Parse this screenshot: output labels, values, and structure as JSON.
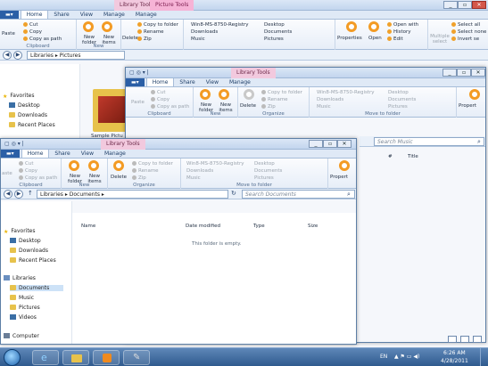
{
  "back": {
    "title_lib": "Library Tools",
    "title_pic": "Picture Tools",
    "tabs": [
      "Home",
      "Share",
      "View",
      "Manage",
      "Manage"
    ],
    "clipboard": {
      "cut": "Cut",
      "copy": "Copy",
      "copy_path": "Copy as path",
      "paste": "Paste",
      "label": "Clipboard"
    },
    "new": {
      "new_folder": "New folder",
      "new_items": "New items",
      "label": "New"
    },
    "organize": {
      "delete": "Delete",
      "copy_to": "Copy to folder",
      "rename": "Rename",
      "zip": "Zip"
    },
    "places": [
      "Win8-MS-8750-Registry",
      "Downloads",
      "Music",
      "Desktop",
      "Documents",
      "Pictures"
    ],
    "open": {
      "properties": "Properties",
      "open": "Open",
      "open_with": "Open with",
      "history": "History",
      "edit": "Edit"
    },
    "select": {
      "multiple": "Multiple select",
      "all": "Select all",
      "none": "Select none",
      "invert": "Invert se"
    },
    "address": "Libraries ▸ Pictures",
    "favorites": "Favorites",
    "fav_items": [
      "Desktop",
      "Downloads",
      "Recent Places"
    ],
    "thumb_label": "Sample Pictu"
  },
  "mid": {
    "title_lib": "Library Tools",
    "tabs": [
      "Home",
      "Share",
      "View",
      "Manage"
    ],
    "clipboard": {
      "cut": "Cut",
      "copy": "Copy",
      "copy_path": "Copy as path",
      "paste": "Paste",
      "label": "Clipboard"
    },
    "new": {
      "new_folder": "New folder",
      "new_items": "New items",
      "label": "New"
    },
    "organize": {
      "delete": "Delete",
      "copy_to": "Copy to folder",
      "rename": "Rename",
      "zip": "Zip",
      "label": "Organize"
    },
    "places": [
      "Win8-MS-8750-Registry",
      "Downloads",
      "Music",
      "Desktop",
      "Documents",
      "Pictures"
    ],
    "move_label": "Move to folder",
    "propert": "Propert",
    "search": "Search Music",
    "col_hash": "#",
    "col_title": "Title"
  },
  "front": {
    "title_lib": "Library Tools",
    "tabs": [
      "Home",
      "Share",
      "View",
      "Manage"
    ],
    "clipboard": {
      "cut": "Cut",
      "copy": "Copy",
      "copy_path": "Copy as path",
      "paste": "aste",
      "label": "Clipboard"
    },
    "new": {
      "new_folder": "New folder",
      "new_items": "New items",
      "label": "New"
    },
    "organize": {
      "delete": "Delete",
      "copy_to": "Copy to folder",
      "rename": "Rename",
      "zip": "Zip",
      "label": "Organize"
    },
    "places": [
      "Win8-MS-8750-Registry",
      "Downloads",
      "Music",
      "Desktop",
      "Documents",
      "Pictures"
    ],
    "move_label": "Move to folder",
    "propert": "Propert",
    "address": "Libraries ▸ Documents ▸",
    "search": "Search Documents",
    "cols": [
      "Name",
      "Date modified",
      "Type",
      "Size"
    ],
    "empty": "This folder is empty.",
    "favorites": "Favorites",
    "fav_items": [
      "Desktop",
      "Downloads",
      "Recent Places"
    ],
    "libraries": "Libraries",
    "lib_items": [
      "Documents",
      "Music",
      "Pictures",
      "Videos"
    ],
    "computer": "Computer"
  },
  "taskbar": {
    "lang": "EN",
    "time": "6:26 AM",
    "date": "4/28/2011"
  }
}
